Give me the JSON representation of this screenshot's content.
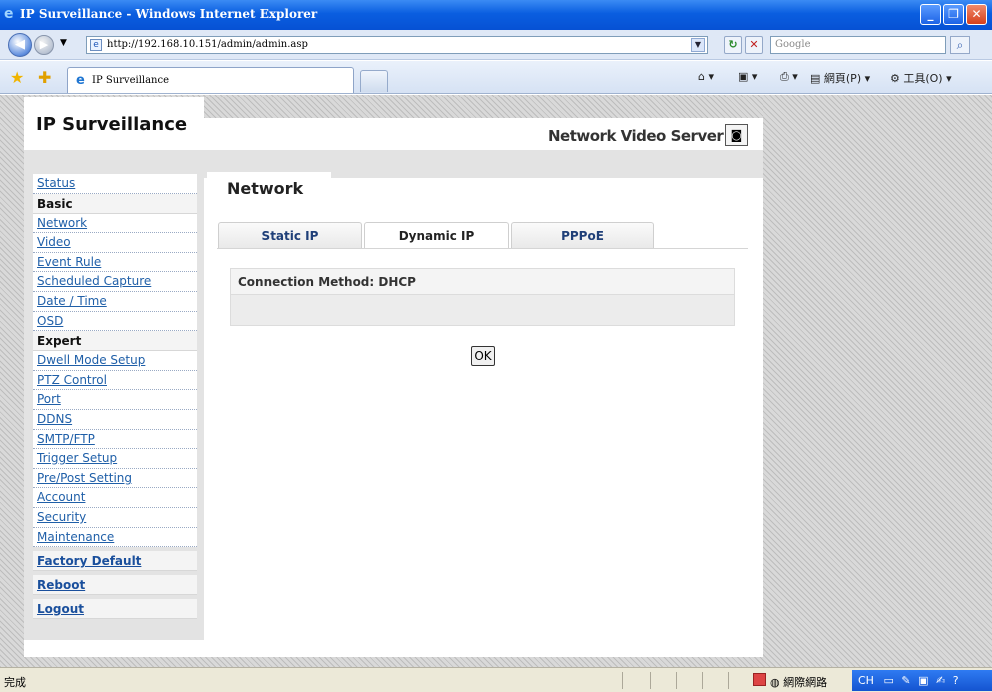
{
  "window": {
    "title": "IP Surveillance - Windows Internet Explorer",
    "controls": [
      "minimize-icon",
      "restore-icon",
      "close-icon"
    ]
  },
  "address": {
    "url": "http://192.168.10.151/admin/admin.asp",
    "search_placeholder": "Google"
  },
  "tabs": [
    {
      "label": "IP Surveillance",
      "active": true
    }
  ],
  "commandbar": {
    "page": "網頁(P)",
    "tools": "工具(O)"
  },
  "header": {
    "logo": "IP Surveillance",
    "product": "Network Video Server"
  },
  "sidebar": {
    "items": [
      {
        "label": "Status",
        "type": "link"
      },
      {
        "label": "Basic",
        "type": "section"
      },
      {
        "label": "Network",
        "type": "link"
      },
      {
        "label": "Video",
        "type": "link"
      },
      {
        "label": "Event Rule",
        "type": "link"
      },
      {
        "label": "Scheduled Capture",
        "type": "link"
      },
      {
        "label": "Date / Time",
        "type": "link"
      },
      {
        "label": "OSD",
        "type": "link"
      },
      {
        "label": "Expert",
        "type": "section"
      },
      {
        "label": "Dwell Mode Setup",
        "type": "link"
      },
      {
        "label": "PTZ Control",
        "type": "link"
      },
      {
        "label": "Port",
        "type": "link"
      },
      {
        "label": "DDNS",
        "type": "link"
      },
      {
        "label": "SMTP/FTP",
        "type": "link"
      },
      {
        "label": "Trigger Setup",
        "type": "link"
      },
      {
        "label": "Pre/Post Setting",
        "type": "link"
      },
      {
        "label": "Account",
        "type": "link"
      },
      {
        "label": "Security",
        "type": "link"
      },
      {
        "label": "Maintenance",
        "type": "link"
      },
      {
        "label": "Factory Default",
        "type": "section-link"
      },
      {
        "label": "Reboot",
        "type": "section-link"
      },
      {
        "label": "Logout",
        "type": "section-link"
      }
    ]
  },
  "main": {
    "page_title": "Network",
    "subtabs": [
      {
        "label": "Static IP",
        "active": false
      },
      {
        "label": "Dynamic IP",
        "active": true
      },
      {
        "label": "PPPoE",
        "active": false
      }
    ],
    "connection_method": "Connection Method: DHCP",
    "ok_label": "OK"
  },
  "status": {
    "done": "完成",
    "zone": "網際網路",
    "tray_lang": "CH"
  }
}
